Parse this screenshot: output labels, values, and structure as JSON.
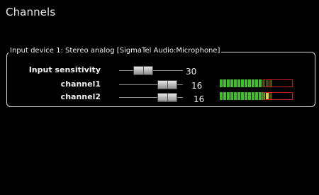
{
  "window": {
    "title": "Channels"
  },
  "group": {
    "legend": "Input device 1: Stereo analog [SigmaTel Audio:Microphone]"
  },
  "rows": [
    {
      "label": "Input sensitivity",
      "value": "30",
      "slider_level": 0.35,
      "has_meter": false
    },
    {
      "label": "channel1",
      "value": "16",
      "slider_level": 0.8,
      "has_meter": true,
      "meter_level": 0.62
    },
    {
      "label": "channel2",
      "value": "16",
      "slider_level": 0.8,
      "has_meter": true,
      "meter_level": 0.72
    }
  ],
  "colors": {
    "background": "#000000",
    "meter_green": "#3fbf2a",
    "meter_yellow": "#e6d23a",
    "meter_red_outline": "#c62020"
  }
}
